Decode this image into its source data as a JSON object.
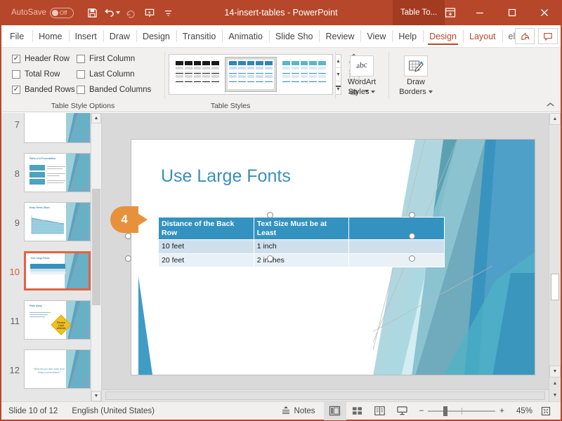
{
  "titlebar": {
    "autosave_label": "AutoSave",
    "autosave_state": "Off",
    "document_title": "14-insert-tables  -  PowerPoint",
    "context_tab_title": "Table To...",
    "qat": [
      {
        "name": "save-icon",
        "label": "Save"
      },
      {
        "name": "undo-icon",
        "label": "Undo"
      },
      {
        "name": "redo-icon",
        "label": "Redo"
      },
      {
        "name": "present-icon",
        "label": "Start From Beginning"
      },
      {
        "name": "customize-qat-icon",
        "label": "Customize Quick Access Toolbar"
      }
    ],
    "window_buttons": [
      {
        "name": "ribbon-display-options-icon",
        "label": "Ribbon Display Options"
      },
      {
        "name": "minimize-icon",
        "label": "Minimize"
      },
      {
        "name": "maximize-icon",
        "label": "Maximize"
      },
      {
        "name": "close-icon",
        "label": "Close"
      }
    ]
  },
  "tabs": [
    {
      "label": "File",
      "id": "file"
    },
    {
      "label": "Home",
      "id": "home"
    },
    {
      "label": "Insert",
      "id": "insert"
    },
    {
      "label": "Draw",
      "id": "draw"
    },
    {
      "label": "Design",
      "id": "design"
    },
    {
      "label": "Transitio",
      "id": "transitions"
    },
    {
      "label": "Animatio",
      "id": "animations"
    },
    {
      "label": "Slide Sho",
      "id": "slideshow"
    },
    {
      "label": "Review",
      "id": "review"
    },
    {
      "label": "View",
      "id": "view"
    },
    {
      "label": "Help",
      "id": "help"
    },
    {
      "label": "Design",
      "id": "table-design"
    },
    {
      "label": "Layout",
      "id": "table-layout"
    },
    {
      "label": "ell me",
      "id": "tellme"
    }
  ],
  "tabrow_right": [
    {
      "name": "share-icon",
      "label": "Share"
    },
    {
      "name": "comments-icon",
      "label": "Comments"
    }
  ],
  "ribbon": {
    "collapse_label": "Collapse the Ribbon",
    "groups": [
      {
        "id": "table-style-options",
        "label": "Table Style Options",
        "checkboxes": [
          {
            "label": "Header Row",
            "checked": true
          },
          {
            "label": "First Column",
            "checked": false
          },
          {
            "label": "Total Row",
            "checked": false
          },
          {
            "label": "Last Column",
            "checked": false
          },
          {
            "label": "Banded Rows",
            "checked": true
          },
          {
            "label": "Banded Columns",
            "checked": false
          }
        ]
      },
      {
        "id": "table-styles",
        "label": "Table Styles",
        "gallery": [
          {
            "name": "table-style-dark",
            "header_color": "#1a1a1a",
            "band_color": "#d9d9d9",
            "selected": false
          },
          {
            "name": "table-style-accent-blue",
            "header_color": "#2e86ba",
            "band_color": "#cfe0ee",
            "selected": true
          },
          {
            "name": "table-style-accent-teal",
            "header_color": "#5bb6cd",
            "band_color": "#dcebf4",
            "selected": false
          }
        ],
        "scroll_buttons": [
          {
            "name": "gallery-scroll-up-icon",
            "glyph": "▲"
          },
          {
            "name": "gallery-scroll-down-icon",
            "glyph": "▼"
          },
          {
            "name": "gallery-more-icon",
            "glyph": "▼"
          }
        ],
        "small_buttons": [
          {
            "name": "shading-button",
            "label": "Shading"
          },
          {
            "name": "borders-button",
            "label": "Borders"
          },
          {
            "name": "effects-button",
            "label": "Effects"
          }
        ]
      },
      {
        "id": "wordart-styles",
        "label": "",
        "button": {
          "name": "wordart-styles-button",
          "line1": "WordArt",
          "line2": "Styles",
          "glyph_label": "abc"
        }
      },
      {
        "id": "draw-borders",
        "label": "",
        "button": {
          "name": "draw-borders-button",
          "line1": "Draw",
          "line2": "Borders"
        }
      }
    ]
  },
  "thumbnails": {
    "scroll_up_label": "▲",
    "scroll_down_label": "▼",
    "items": [
      {
        "number": "7",
        "title": "",
        "active": false,
        "kind": "plain"
      },
      {
        "number": "8",
        "title": "Parts of a Presentation",
        "active": false,
        "kind": "blocks"
      },
      {
        "number": "9",
        "title": "Keep Views Short",
        "active": false,
        "kind": "chart"
      },
      {
        "number": "10",
        "title": "Use Large Fonts",
        "active": true,
        "kind": "table"
      },
      {
        "number": "11",
        "title": "Plain Away",
        "active": false,
        "kind": "sign"
      },
      {
        "number": "12",
        "title": "",
        "active": false,
        "kind": "question"
      }
    ],
    "slide8_blocks": [
      "Opening",
      "Body",
      "Close"
    ],
    "slide11_sign": "Please Limit Animation",
    "slide12_text": "What did you take away from today's presentation?"
  },
  "slide": {
    "title": "Use Large Fonts",
    "table": {
      "columns": [
        "Distance of the Back Row",
        "Text Size Must be at Least",
        ""
      ],
      "rows": [
        [
          "10 feet",
          "1 inch",
          ""
        ],
        [
          "20 feet",
          "2 inches",
          ""
        ]
      ]
    },
    "callout_number": "4",
    "selection_label": "table-selection-handles"
  },
  "statusbar": {
    "slide_counter": "Slide 10 of 12",
    "language": "English (United States)",
    "notes_label": "Notes",
    "views": [
      {
        "name": "normal-view-button",
        "label": "Normal",
        "active": true
      },
      {
        "name": "slide-sorter-view-button",
        "label": "Slide Sorter",
        "active": false
      },
      {
        "name": "reading-view-button",
        "label": "Reading View",
        "active": false
      },
      {
        "name": "slideshow-view-button",
        "label": "Slide Show",
        "active": false
      }
    ],
    "zoom_out_label": "−",
    "zoom_in_label": "+",
    "zoom_percent": "45%",
    "fit_label": "Fit slide to current window"
  },
  "colors": {
    "brand": "#b7472a",
    "context_tab": "#a23b20",
    "accent_blue": "#3392c0",
    "slide_title": "#3a8fba",
    "callout_orange": "#e8913c",
    "selected_thumb": "#e06442"
  }
}
